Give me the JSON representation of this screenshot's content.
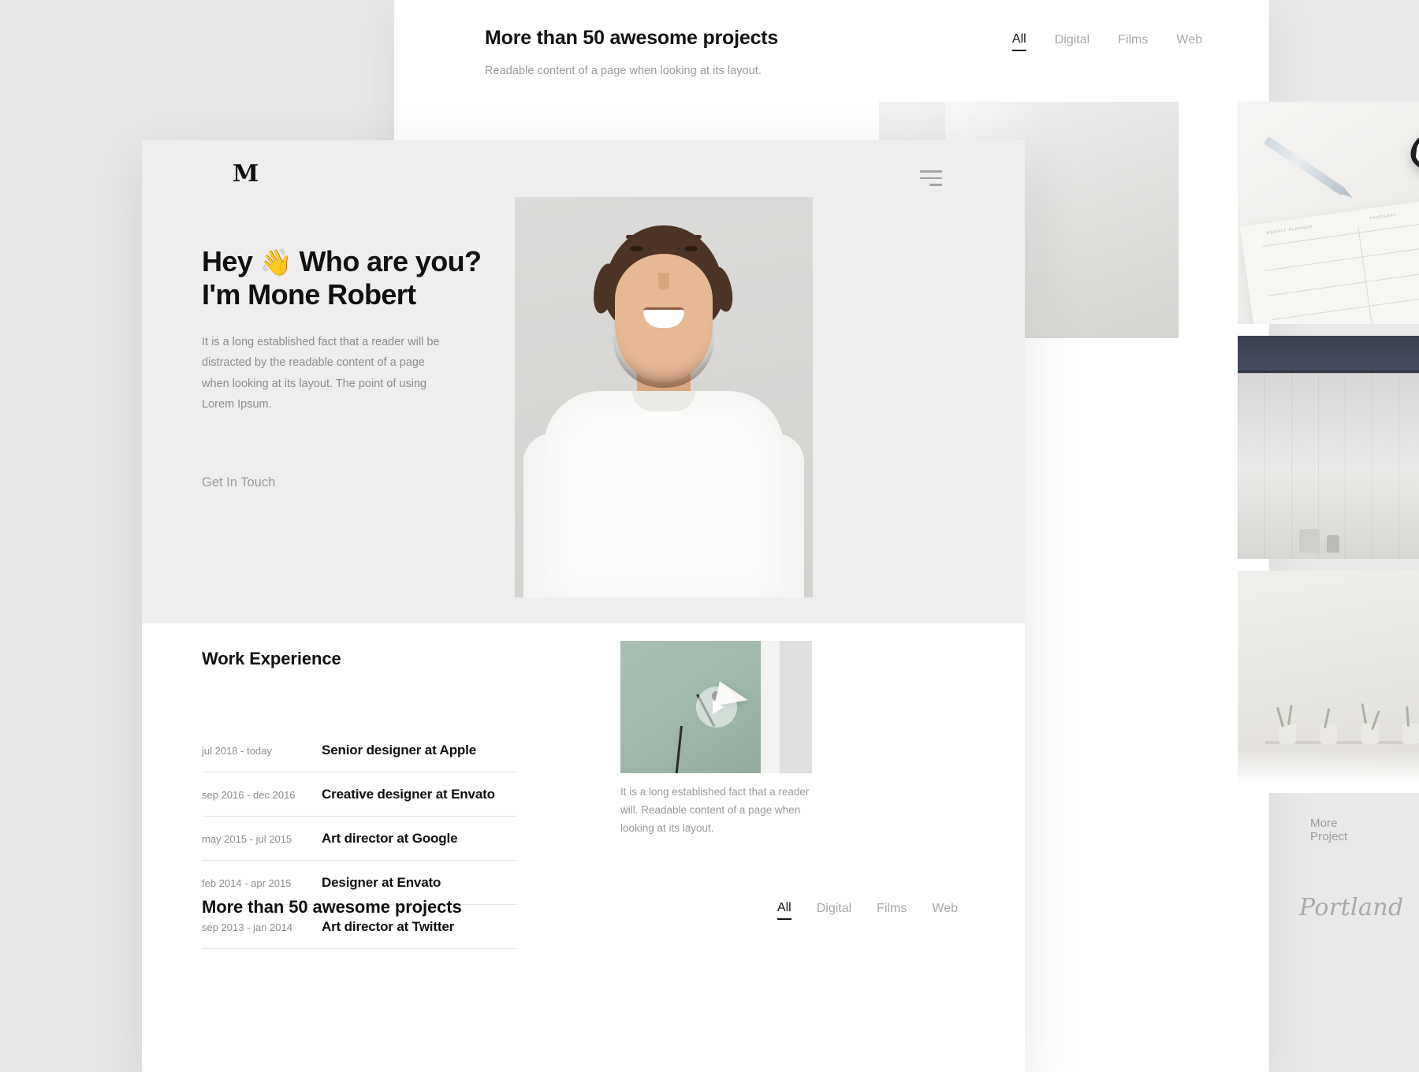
{
  "back_page": {
    "title": "More than 50 awesome projects",
    "subtitle": "Readable content of a page when looking at its layout.",
    "filters": [
      {
        "label": "All",
        "active": true
      },
      {
        "label": "Digital",
        "active": false
      },
      {
        "label": "Films",
        "active": false
      },
      {
        "label": "Web",
        "active": false
      }
    ],
    "more_project_label": "More Project",
    "portland_label": "Portland"
  },
  "front_page": {
    "logo": "M",
    "menu_icon": "hamburger-icon",
    "hero": {
      "heading_line1_before": "Hey ",
      "heading_emoji": "👋",
      "heading_line1_after": " Who are you?",
      "heading_line2": "I'm Mone Robert",
      "paragraph": "It is a long established fact that a reader will be distracted by the readable content of a page when looking at its layout. The point of using Lorem Ipsum.",
      "cta_label": "Get In Touch"
    },
    "work": {
      "title": "Work Experience",
      "rows": [
        {
          "date": "jul 2018 - today",
          "role": "Senior designer at Apple"
        },
        {
          "date": "sep 2016 - dec 2016",
          "role": "Creative designer at Envato"
        },
        {
          "date": "may 2015 - jul 2015",
          "role": "Art director at Google"
        },
        {
          "date": "feb 2014 - apr 2015",
          "role": "Designer at Envato"
        },
        {
          "date": "sep 2013 - jan 2014",
          "role": "Art director at Twitter"
        }
      ]
    },
    "video": {
      "play_icon": "play-icon",
      "caption": "It is a long established fact that a reader will. Readable content of a page when looking at its layout."
    },
    "projects": {
      "title": "More than 50 awesome projects",
      "filters": [
        {
          "label": "All",
          "active": true
        },
        {
          "label": "Digital",
          "active": false
        },
        {
          "label": "Films",
          "active": false
        },
        {
          "label": "Web",
          "active": false
        }
      ]
    }
  },
  "colors": {
    "text_dark": "#0f0f0f",
    "text_muted": "#8d8d8d",
    "hero_bg": "#efeeee",
    "page_bg": "#ffffff",
    "ambient": "#e8e8e8"
  }
}
